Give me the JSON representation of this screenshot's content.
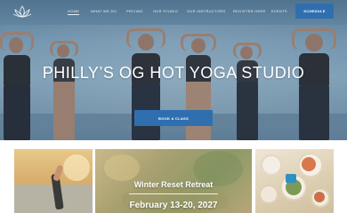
{
  "nav": {
    "items": [
      {
        "label": "HOME",
        "active": true
      },
      {
        "label": "WHAT WE DO",
        "active": false
      },
      {
        "label": "PRICING",
        "active": false
      },
      {
        "label": "OUR STUDIO",
        "active": false
      },
      {
        "label": "OUR INSTRUCTORS",
        "active": false
      },
      {
        "label": "REGISTER HERE",
        "active": false
      },
      {
        "label": "EVENTS",
        "active": false
      }
    ],
    "schedule_label": "SCHEDULE",
    "logo_icon": "lotus-logo-icon"
  },
  "hero": {
    "title": "PHILLY’S OG HOT YOGA STUDIO",
    "book_label": "BOOK A CLASS"
  },
  "cards": {
    "retreat_title": "Winter Reset Retreat",
    "retreat_date": "February 13-20, 2027"
  },
  "colors": {
    "accent": "#2f6fb0",
    "hero_text": "#ffffff"
  }
}
